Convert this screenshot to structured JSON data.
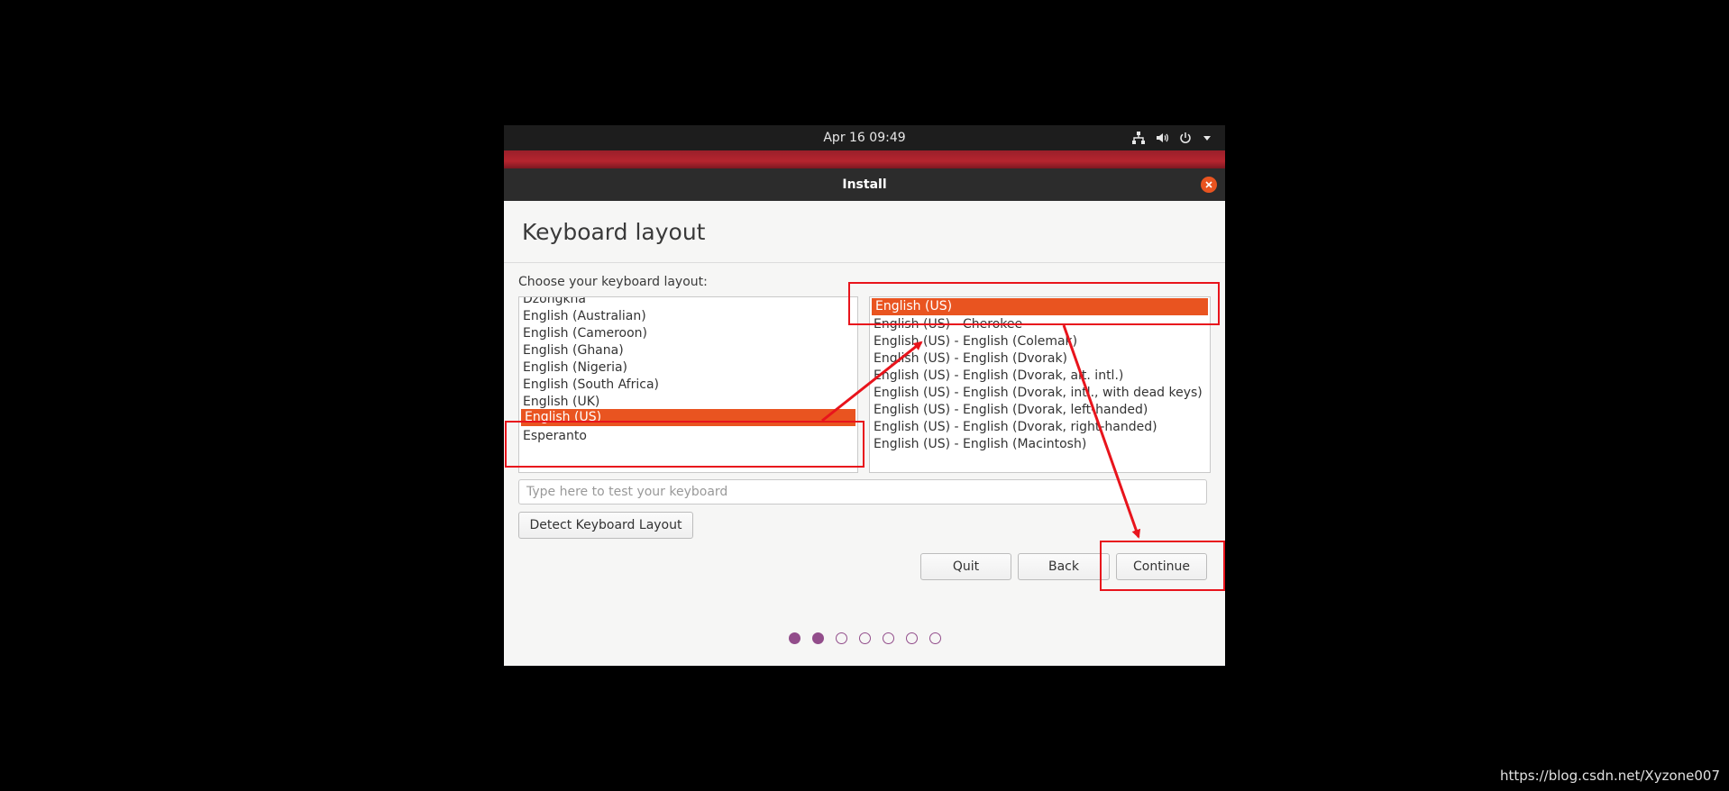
{
  "topbar": {
    "clock": "Apr 16  09:49",
    "icons": [
      "network-icon",
      "volume-icon",
      "power-icon",
      "menu-arrow-icon"
    ]
  },
  "window": {
    "title": "Install",
    "close_icon": "close-icon"
  },
  "page": {
    "heading": "Keyboard layout",
    "prompt": "Choose your keyboard layout:"
  },
  "layouts": {
    "items": [
      "Dzongkha",
      "English (Australian)",
      "English (Cameroon)",
      "English (Ghana)",
      "English (Nigeria)",
      "English (South Africa)",
      "English (UK)",
      "English (US)",
      "Esperanto"
    ],
    "selected": "English (US)"
  },
  "variants": {
    "items": [
      "English (US)",
      "English (US) - Cherokee",
      "English (US) - English (Colemak)",
      "English (US) - English (Dvorak)",
      "English (US) - English (Dvorak, alt. intl.)",
      "English (US) - English (Dvorak, intl., with dead keys)",
      "English (US) - English (Dvorak, left-handed)",
      "English (US) - English (Dvorak, right-handed)",
      "English (US) - English (Macintosh)"
    ],
    "selected": "English (US)"
  },
  "test_input": {
    "placeholder": "Type here to test your keyboard",
    "value": ""
  },
  "buttons": {
    "detect": "Detect Keyboard Layout",
    "quit": "Quit",
    "back": "Back",
    "continue": "Continue"
  },
  "progress": {
    "total_steps": 7,
    "completed_steps": 2
  },
  "colors": {
    "accent": "#e95420",
    "progress": "#924d8b",
    "annotation": "#e8141c"
  },
  "watermark": "https://blog.csdn.net/Xyzone007"
}
